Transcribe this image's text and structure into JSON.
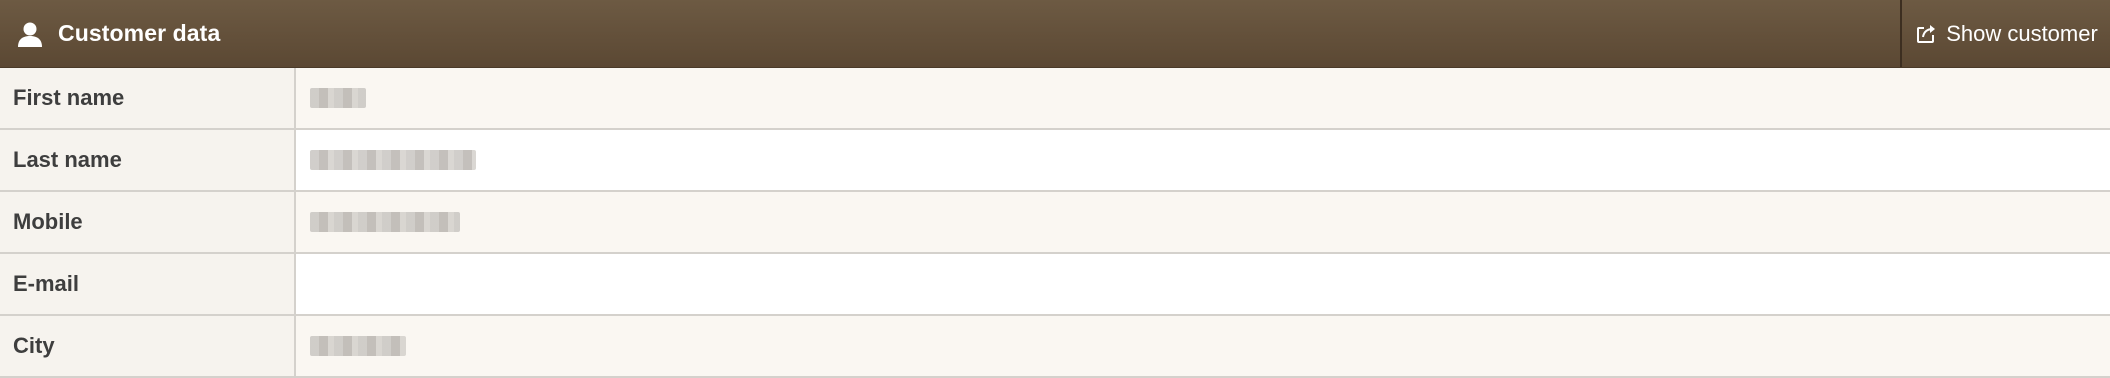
{
  "header": {
    "title": "Customer data",
    "show_customer_label": "Show customer"
  },
  "fields": [
    {
      "label": "First name"
    },
    {
      "label": "Last name"
    },
    {
      "label": "Mobile"
    },
    {
      "label": "E-mail"
    },
    {
      "label": "City"
    }
  ],
  "colors": {
    "header_background": "#635039",
    "label_background": "#f6f3ee",
    "row_alt_background": "#faf7f2",
    "border": "#d4d1cc"
  },
  "icons": {
    "header": "user-icon",
    "show_customer": "external-link-icon"
  }
}
